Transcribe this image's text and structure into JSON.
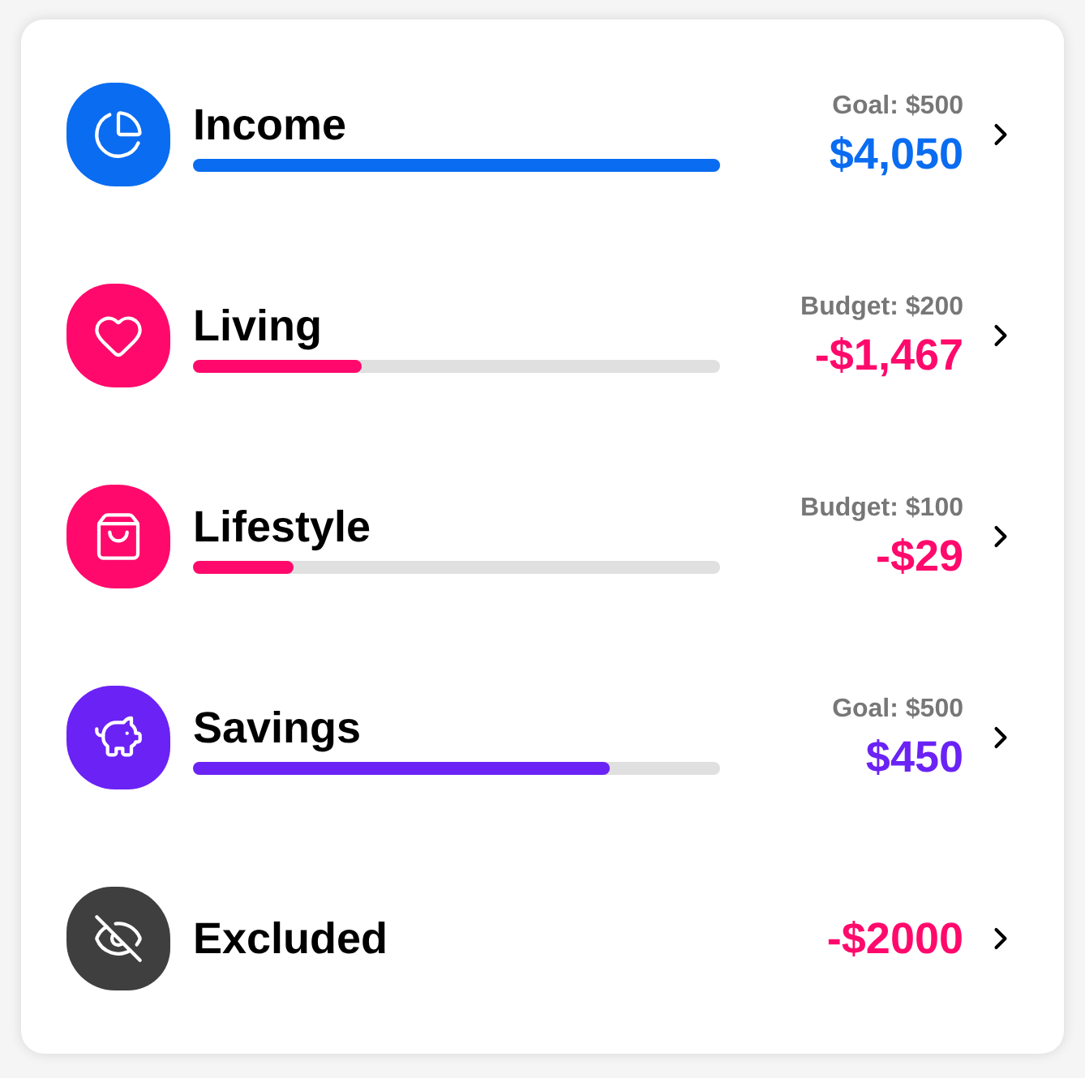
{
  "categories": [
    {
      "kind": "bar",
      "name": "Income",
      "caption": "Goal: $500",
      "amount": "$4,050",
      "color": "#0a6cf0",
      "negative": false,
      "level": 1.0
    },
    {
      "kind": "bar",
      "name": "Living",
      "caption": "Budget: $200",
      "amount": "-$1,467",
      "color": "#ff0a6c",
      "negative": true,
      "level": 0.32
    },
    {
      "kind": "bar",
      "name": "Lifestyle",
      "caption": "Budget: $100",
      "amount": "-$29",
      "color": "#ff0a6c",
      "negative": true,
      "level": 0.19
    },
    {
      "kind": "bar",
      "name": "Savings",
      "caption": "Goal: $500",
      "amount": "$450",
      "color": "#6b22f5",
      "negative": false,
      "level": 0.79
    },
    {
      "kind": "plain",
      "name": "Excluded",
      "amount": "-$2000",
      "color": "#3f3f3f",
      "negative": true
    }
  ]
}
